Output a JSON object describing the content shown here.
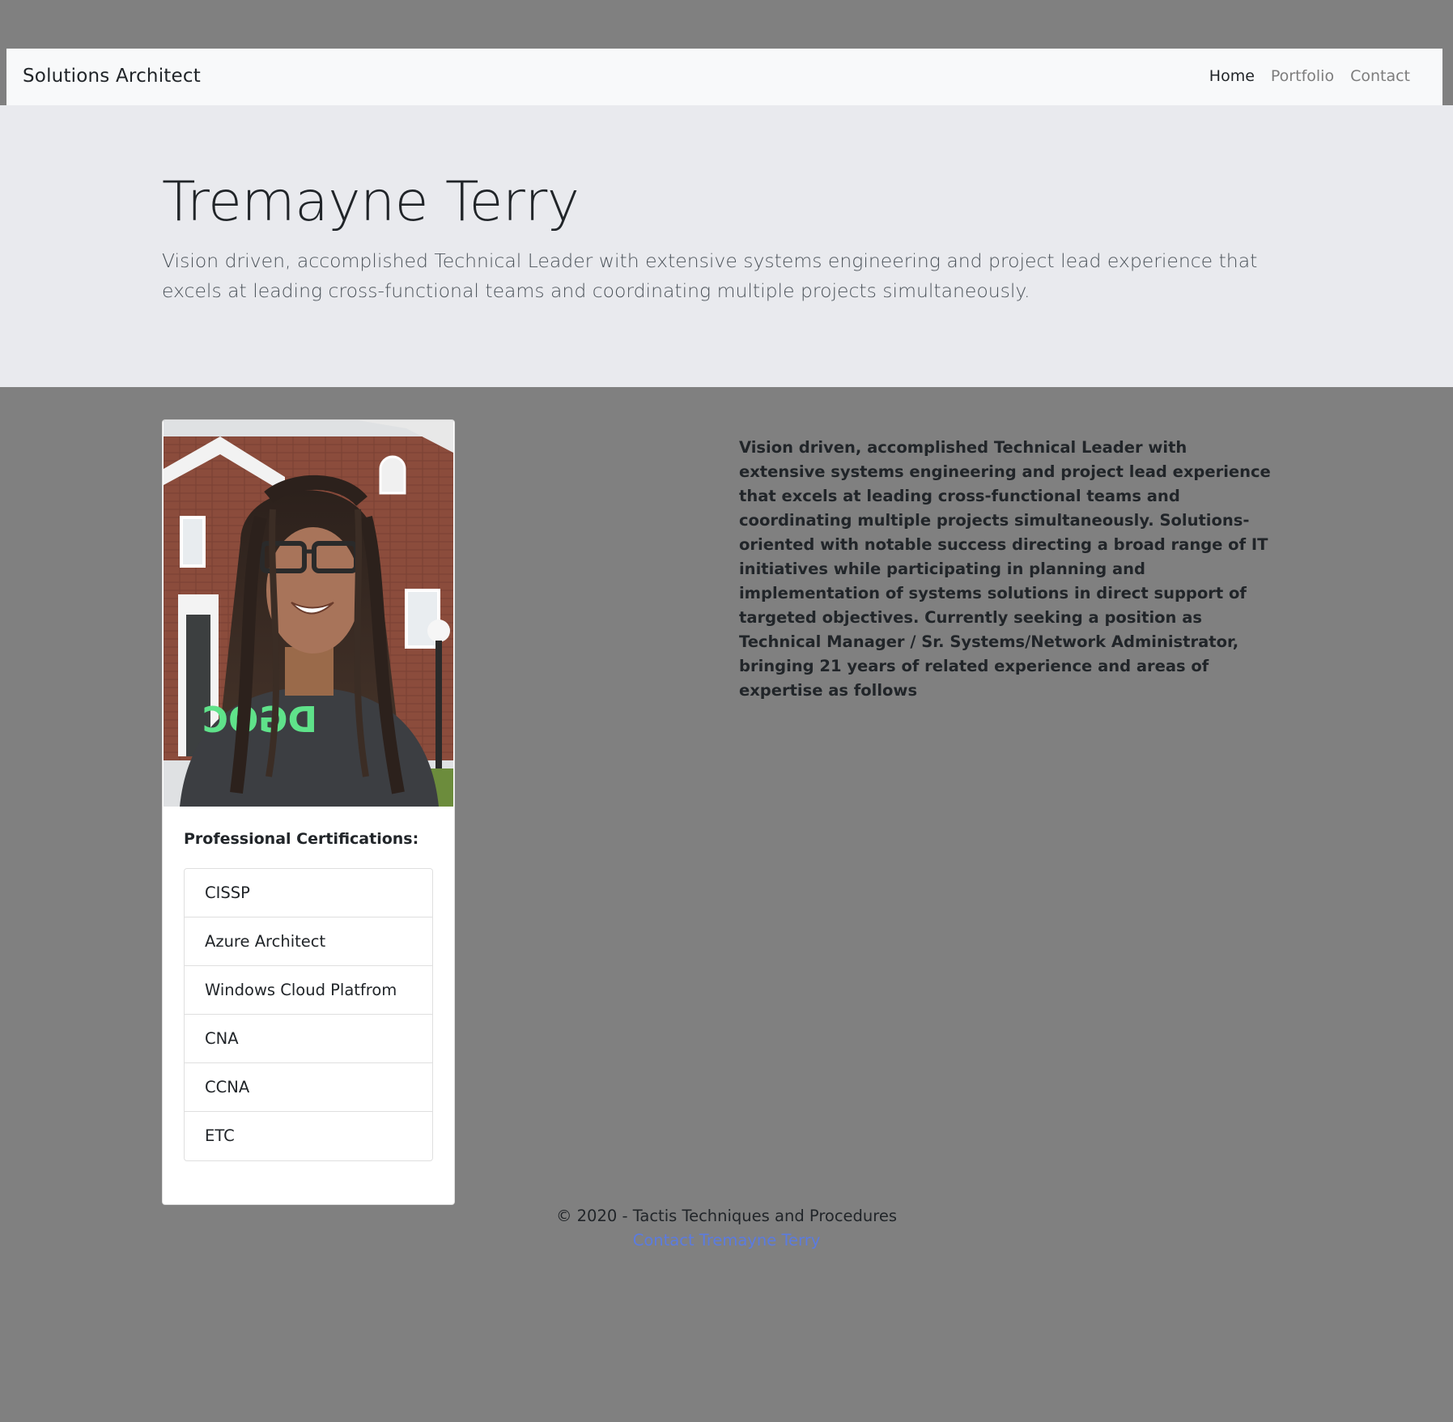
{
  "navbar": {
    "brand": "Solutions Architect",
    "links": [
      {
        "label": "Home",
        "active": true
      },
      {
        "label": "Portfolio",
        "active": false
      },
      {
        "label": "Contact",
        "active": false
      }
    ]
  },
  "hero": {
    "title": "Tremayne Terry",
    "lead": "Vision driven, accomplished Technical Leader with extensive systems engineering and project lead experience that excels at leading cross-functional teams and coordinating multiple projects simultaneously."
  },
  "profile_card": {
    "photo_alt": "Tremayne Terry profile photo",
    "certifications_title": "Professional Certifications:",
    "certifications": [
      "CISSP",
      "Azure Architect",
      "Windows Cloud Platfrom",
      "CNA",
      "CCNA",
      "ETC"
    ]
  },
  "bio": "Vision driven, accomplished Technical Leader with extensive systems engineering and project lead experience that excels at leading cross-functional teams and coordinating multiple projects simultaneously. Solutions-oriented with notable success directing a broad range of IT initiatives while participating in planning and implementation of systems solutions in direct support of targeted objectives. Currently seeking a position as Technical Manager / Sr. Systems/Network Administrator, bringing 21 years of related experience and areas of expertise as follows",
  "footer": {
    "copyright": "© 2020 - Tactis Techniques and Procedures",
    "contact_link": "Contact Tremayne Terry"
  },
  "colors": {
    "page_bg": "#808080",
    "navbar_bg": "#f8f9fa",
    "jumbotron_bg": "#e9eaee",
    "link": "#5b7be0"
  }
}
